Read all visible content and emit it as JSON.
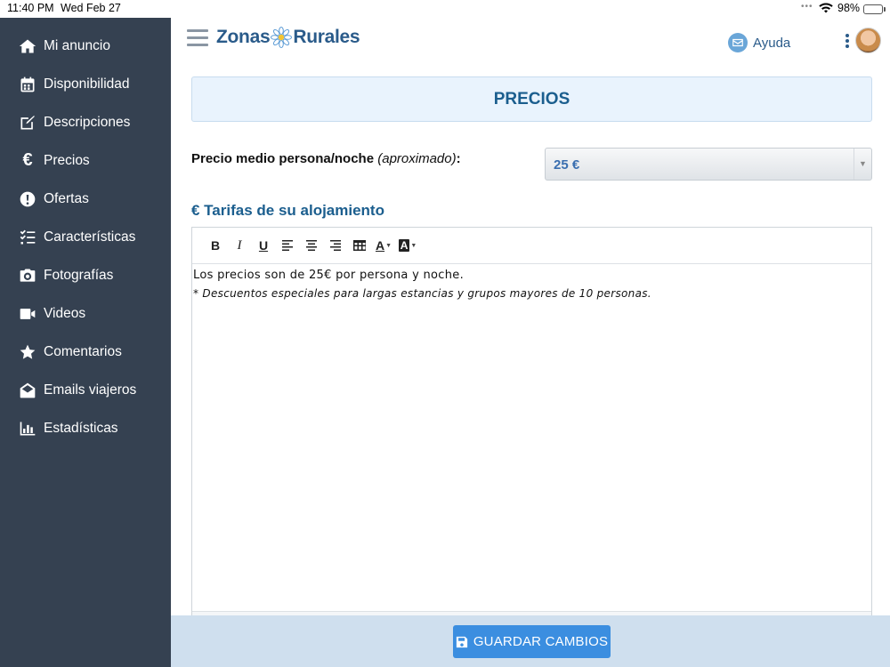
{
  "status_bar": {
    "time": "11:40 PM",
    "date": "Wed Feb 27",
    "battery": "98%",
    "battery_level": 0.98
  },
  "sidebar": {
    "items": [
      {
        "label": "Mi anuncio",
        "icon": "home-icon"
      },
      {
        "label": "Disponibilidad",
        "icon": "calendar-icon"
      },
      {
        "label": "Descripciones",
        "icon": "edit-icon"
      },
      {
        "label": "Precios",
        "icon": "euro-icon"
      },
      {
        "label": "Ofertas",
        "icon": "exclamation-circle-icon"
      },
      {
        "label": "Características",
        "icon": "checklist-icon"
      },
      {
        "label": "Fotografías",
        "icon": "camera-icon"
      },
      {
        "label": "Videos",
        "icon": "video-camera-icon"
      },
      {
        "label": "Comentarios",
        "icon": "star-icon"
      },
      {
        "label": "Emails viajeros",
        "icon": "envelope-open-icon"
      },
      {
        "label": "Estadísticas",
        "icon": "bar-chart-icon"
      }
    ]
  },
  "header": {
    "logo_left": "Zonas",
    "logo_right": "Rurales",
    "help_label": "Ayuda"
  },
  "page": {
    "title": "PRECIOS",
    "price_label": "Precio medio persona/noche",
    "price_label_note": "(aproximado)",
    "price_label_suffix": ":",
    "price_value": "25 €",
    "section_title": "€ Tarifas de su alojamiento",
    "editor_line1": "Los precios son de 25€ por persona y noche.",
    "editor_line2": "* Descuentos especiales para largas estancias y grupos mayores de 10 personas.",
    "save_label": "GUARDAR CAMBIOS"
  },
  "toolbar": {
    "bold": "B",
    "italic": "I",
    "underline": "U",
    "font_color": "A",
    "bg_color": "A"
  },
  "colors": {
    "sidebar_bg": "#354151",
    "accent": "#1b5e8e",
    "save_button": "#3b8ee0",
    "title_bg": "#e9f3fd",
    "footer_bg": "#cfdfee"
  }
}
